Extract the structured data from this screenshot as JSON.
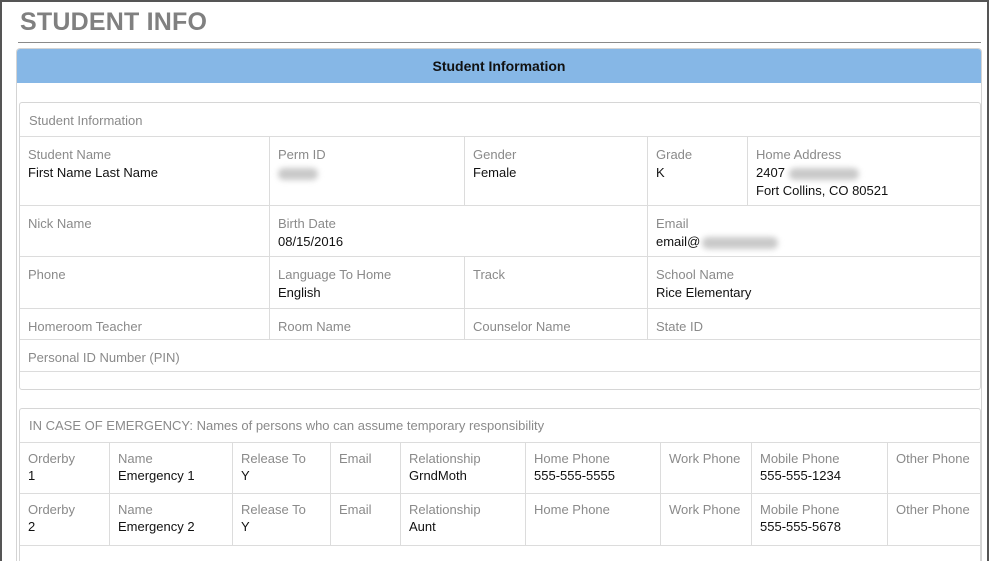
{
  "page": {
    "title": "STUDENT INFO"
  },
  "panel": {
    "header": "Student Information"
  },
  "student_info": {
    "section_title": "Student Information",
    "student_name": {
      "label": "Student Name",
      "value": "First Name Last Name"
    },
    "perm_id": {
      "label": "Perm ID"
    },
    "gender": {
      "label": "Gender",
      "value": "Female"
    },
    "grade": {
      "label": "Grade",
      "value": "K"
    },
    "home_address": {
      "label": "Home Address",
      "line1": "2407",
      "line2": "Fort Collins, CO 80521"
    },
    "nick_name": {
      "label": "Nick Name"
    },
    "birth_date": {
      "label": "Birth Date",
      "value": "08/15/2016"
    },
    "email": {
      "label": "Email",
      "value": "email@"
    },
    "phone": {
      "label": "Phone"
    },
    "language": {
      "label": "Language To Home",
      "value": "English"
    },
    "track": {
      "label": "Track"
    },
    "school_name": {
      "label": "School Name",
      "value": "Rice Elementary"
    },
    "homeroom_teacher": {
      "label": "Homeroom Teacher"
    },
    "room_name": {
      "label": "Room Name"
    },
    "counselor_name": {
      "label": "Counselor Name"
    },
    "state_id": {
      "label": "State ID"
    },
    "pin": {
      "label": "Personal ID Number (PIN)"
    }
  },
  "emergency": {
    "section_title": "IN CASE OF EMERGENCY: Names of persons who can assume temporary responsibility",
    "labels": {
      "orderby": "Orderby",
      "name": "Name",
      "release_to": "Release To",
      "email": "Email",
      "relationship": "Relationship",
      "home_phone": "Home Phone",
      "work_phone": "Work Phone",
      "mobile_phone": "Mobile Phone",
      "other_phone": "Other Phone"
    },
    "contacts": [
      {
        "orderby": "1",
        "name": "Emergency 1",
        "release_to": "Y",
        "email": "",
        "relationship": "GrndMoth",
        "home_phone": "555-555-5555",
        "work_phone": "",
        "mobile_phone": "555-555-1234",
        "other_phone": ""
      },
      {
        "orderby": "2",
        "name": "Emergency 2",
        "release_to": "Y",
        "email": "",
        "relationship": "Aunt",
        "home_phone": "",
        "work_phone": "",
        "mobile_phone": "555-555-5678",
        "other_phone": ""
      }
    ]
  }
}
